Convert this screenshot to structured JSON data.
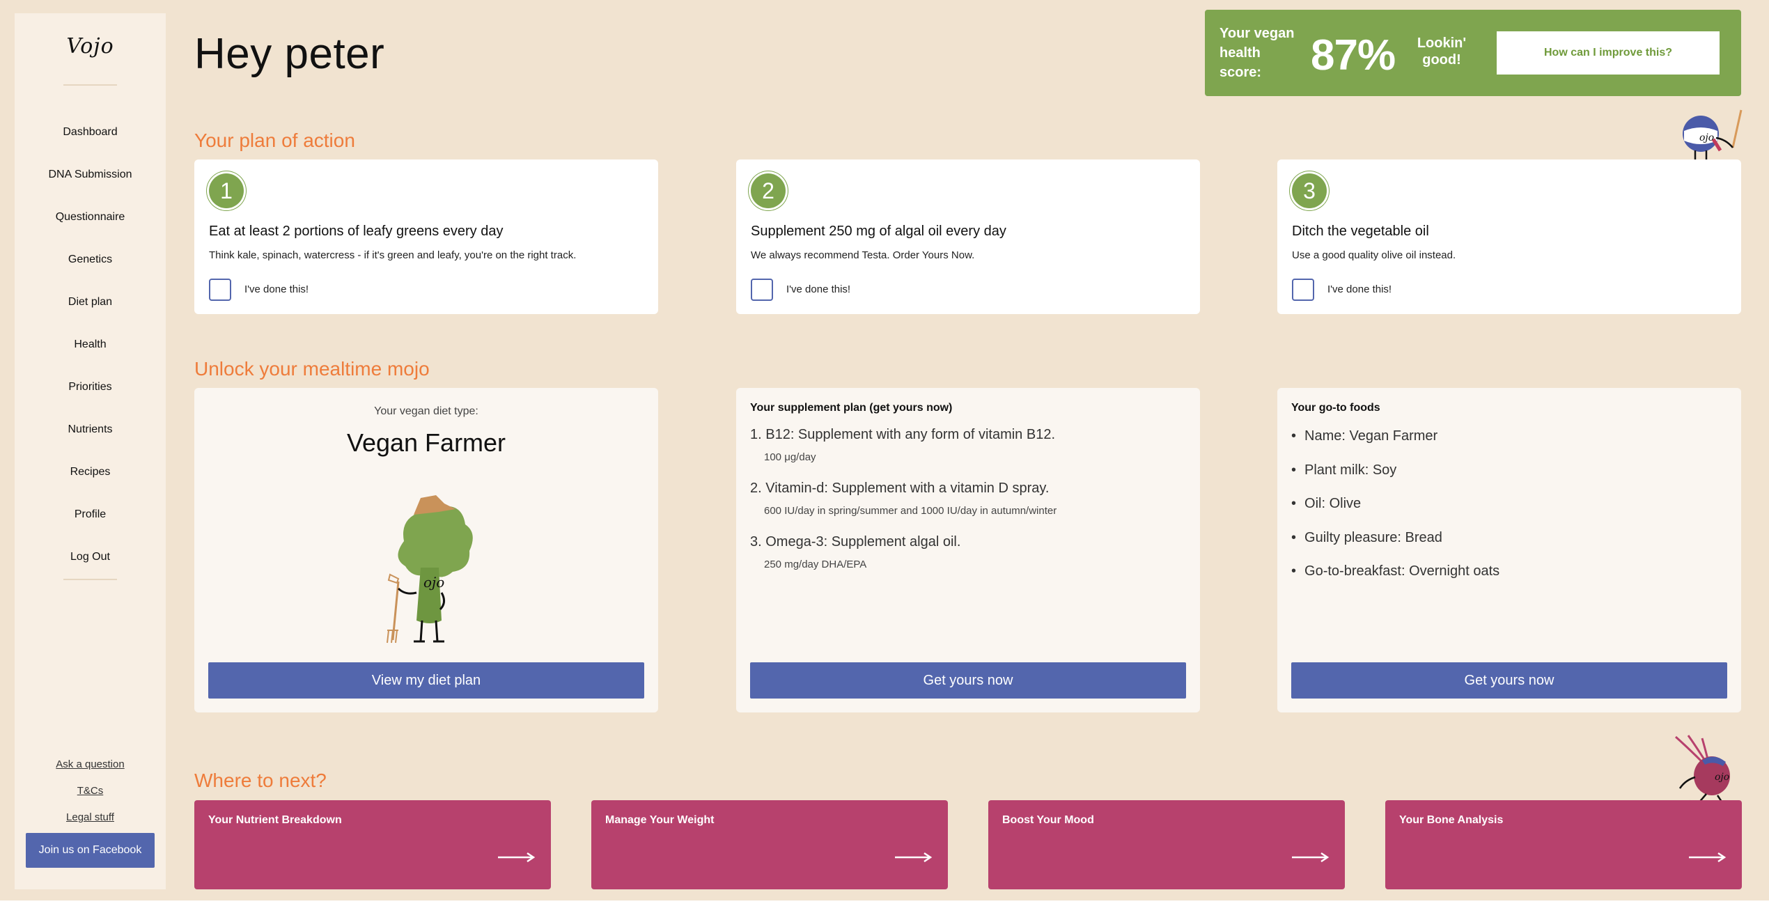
{
  "sidebar": {
    "logo": "Vojo",
    "nav": [
      "Dashboard",
      "DNA Submission",
      "Questionnaire",
      "Genetics",
      "Diet plan",
      "Health",
      "Priorities",
      "Nutrients",
      "Recipes",
      "Profile",
      "Log Out"
    ],
    "links": [
      "Ask a question",
      "T&Cs",
      "Legal stuff"
    ],
    "facebook_button": "Join us on Facebook"
  },
  "header": {
    "greeting": "Hey peter",
    "score_label": "Your vegan health score:",
    "score_value": "87%",
    "score_message": "Lookin' good!",
    "improve_button": "How can I improve this?"
  },
  "plan": {
    "title": "Your plan of action",
    "done_label": "I've done this!",
    "items": [
      {
        "number": "1",
        "title": "Eat at least 2 portions of leafy greens every day",
        "description": "Think kale, spinach, watercress - if it's green and leafy, you're on the right track."
      },
      {
        "number": "2",
        "title": "Supplement 250 mg of algal oil every day",
        "description": "We always recommend Testa. Order Yours Now."
      },
      {
        "number": "3",
        "title": "Ditch the vegetable oil",
        "description": "Use a good quality olive oil instead."
      }
    ]
  },
  "mojo": {
    "title": "Unlock your mealtime mojo",
    "diet_label": "Your vegan diet type:",
    "diet_type": "Vegan Farmer",
    "diet_button": "View my diet plan",
    "supplement_heading": "Your supplement plan (get yours now)",
    "supplements": [
      {
        "main": "1. B12: Supplement with any form of vitamin B12.",
        "sub": "100 μg/day"
      },
      {
        "main": "2. Vitamin-d: Supplement with a vitamin D spray.",
        "sub": "600 IU/day in spring/summer and 1000 IU/day in autumn/winter"
      },
      {
        "main": "3. Omega-3: Supplement algal oil.",
        "sub": "250 mg/day DHA/EPA"
      }
    ],
    "supplement_button": "Get yours now",
    "foods_heading": "Your go-to foods",
    "foods": [
      "Name: Vegan Farmer",
      "Plant milk: Soy",
      "Oil: Olive",
      "Guilty pleasure: Bread",
      "Go-to-breakfast: Overnight oats"
    ],
    "foods_button": "Get yours now"
  },
  "next": {
    "title": "Where to next?",
    "items": [
      "Your Nutrient Breakdown",
      "Manage Your Weight",
      "Boost Your Mood",
      "Your Bone Analysis"
    ]
  },
  "colors": {
    "background": "#f1e3d0",
    "accent_orange": "#ee7c3b",
    "green": "#7fa54f",
    "blue_button": "#5366ad",
    "magenta": "#b7416d"
  },
  "mascot_text": "ojo"
}
